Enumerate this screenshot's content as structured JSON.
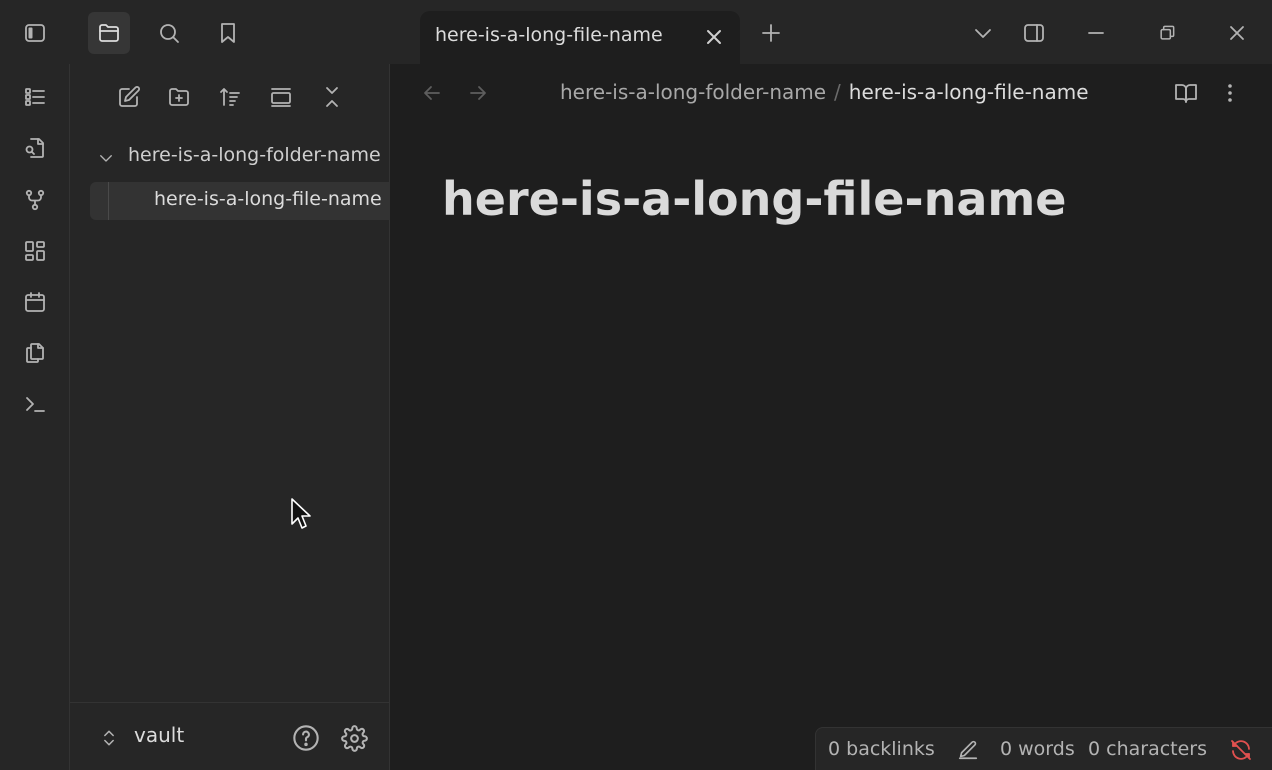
{
  "titlebar": {
    "tab_title": "here-is-a-long-file-name"
  },
  "explorer": {
    "folder_name": "here-is-a-long-folder-name",
    "file_name": "here-is-a-long-file-name",
    "vault_name": "vault"
  },
  "main": {
    "breadcrumb_folder": "here-is-a-long-folder-name",
    "breadcrumb_separator": "/",
    "breadcrumb_file": "here-is-a-long-file-name",
    "note_title": "here-is-a-long-file-name"
  },
  "statusbar": {
    "backlinks": "0 backlinks",
    "words": "0 words",
    "characters": "0 characters"
  },
  "icons": {
    "sidebar_toggle": "sidebar-left-icon",
    "files": "folder-icon",
    "search": "search-icon",
    "bookmarks": "bookmark-icon",
    "sync_status": "sync-off-icon"
  },
  "colors": {
    "accent_error": "#e0504f",
    "background": "#1e1e1e",
    "panel": "#262626"
  }
}
